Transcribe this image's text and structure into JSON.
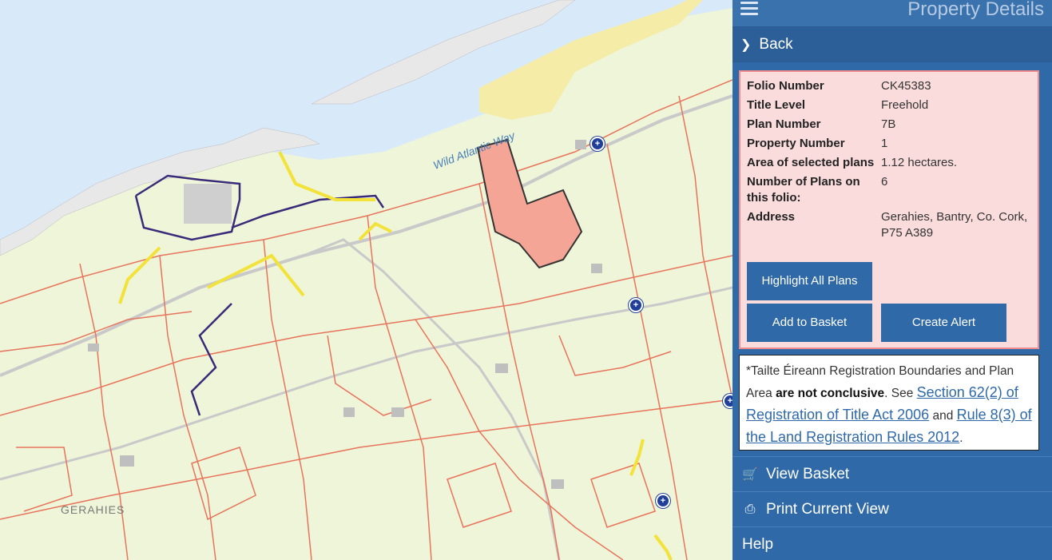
{
  "map": {
    "road_label": "Wild Atlantic Way",
    "place_label": "GERAHIES",
    "colors": {
      "water": "#d8eaf9",
      "land": "#f1f6dc",
      "boundary": "#e8745c",
      "parcel": "#f7b0a2",
      "road": "#c9c9c9",
      "beach": "#f5eca8"
    }
  },
  "sidebar": {
    "title": "Property Details",
    "back_label": "Back",
    "details": [
      {
        "label": "Folio Number",
        "value": "CK45383"
      },
      {
        "label": "Title Level",
        "value": "Freehold"
      },
      {
        "label": "Plan Number",
        "value": "7B"
      },
      {
        "label": "Property Number",
        "value": "1"
      },
      {
        "label": "Area of selected plans",
        "value": "1.12 hectares."
      },
      {
        "label": "Number of Plans on this folio:",
        "value": "6"
      },
      {
        "label": "Address",
        "value": "Gerahies, Bantry, Co. Cork, P75 A389"
      }
    ],
    "buttons": {
      "highlight": "Highlight All Plans",
      "basket": "Add to Basket",
      "alert": "Create Alert"
    },
    "disclaimer": {
      "prefix": "*Tailte Éireann Registration Boundaries and Plan Area ",
      "bold": "are not conclusive",
      "mid": ". See ",
      "link1": "Section 62(2) of Registration of Title Act 2006",
      "and": " and ",
      "link2": "Rule 8(3) of the Land Registration Rules 2012",
      "suffix": "."
    },
    "menu": {
      "view_basket": "View Basket",
      "print": "Print Current View",
      "help": "Help"
    }
  }
}
